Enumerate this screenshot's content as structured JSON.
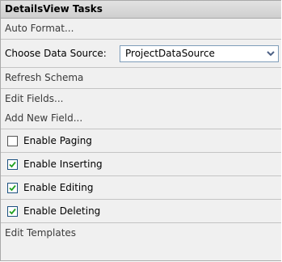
{
  "panel": {
    "title": "DetailsView Tasks"
  },
  "tasks": {
    "auto_format": "Auto Format...",
    "choose_data_source_label": "Choose Data Source:",
    "data_source_value": "ProjectDataSource",
    "refresh_schema": "Refresh Schema",
    "edit_fields": "Edit Fields...",
    "add_new_field": "Add New Field...",
    "edit_templates": "Edit Templates"
  },
  "options": [
    {
      "label": "Enable Paging",
      "checked": false
    },
    {
      "label": "Enable Inserting",
      "checked": true
    },
    {
      "label": "Enable Editing",
      "checked": true
    },
    {
      "label": "Enable Deleting",
      "checked": true
    }
  ],
  "colors": {
    "panel_background": "#f0f0f0",
    "border": "#a9a9a9",
    "checkmark": "#21a121",
    "combo_border": "#7f9db9"
  }
}
